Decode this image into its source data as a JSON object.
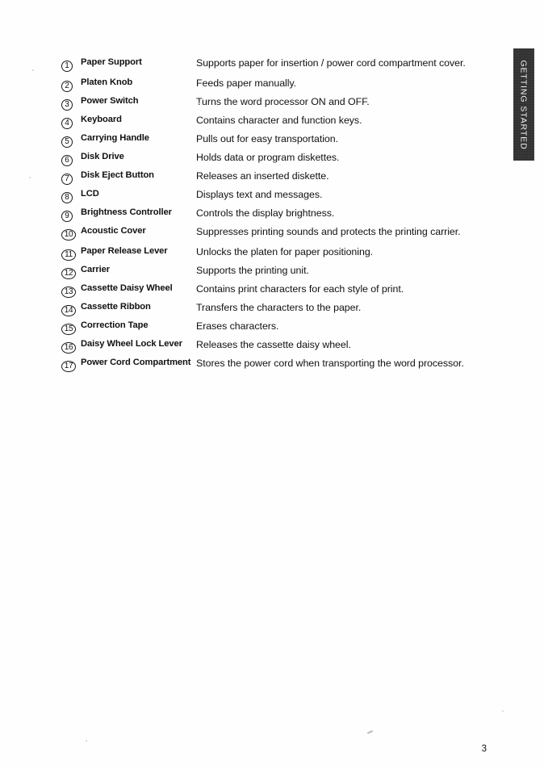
{
  "document": {
    "page_number": "3",
    "side_tab_label": "GETTING STARTED"
  },
  "parts_list": {
    "items": [
      {
        "number": "1",
        "label": "Paper Support",
        "description": "Supports paper for insertion / power cord compartment cover."
      },
      {
        "number": "2",
        "label": "Platen Knob",
        "description": "Feeds paper manually."
      },
      {
        "number": "3",
        "label": "Power Switch",
        "description": "Turns the word processor ON and OFF."
      },
      {
        "number": "4",
        "label": "Keyboard",
        "description": "Contains character and function keys."
      },
      {
        "number": "5",
        "label": "Carrying Handle",
        "description": "Pulls out for easy transportation."
      },
      {
        "number": "6",
        "label": "Disk Drive",
        "description": "Holds data or program diskettes."
      },
      {
        "number": "7",
        "label": "Disk Eject Button",
        "description": "Releases an inserted diskette."
      },
      {
        "number": "8",
        "label": "LCD",
        "description": "Displays text and messages."
      },
      {
        "number": "9",
        "label": "Brightness Controller",
        "description": "Controls the display brightness."
      },
      {
        "number": "10",
        "label": "Acoustic Cover",
        "description": "Suppresses printing sounds and protects the printing carrier."
      },
      {
        "number": "11",
        "label": "Paper Release Lever",
        "description": "Unlocks the platen for paper positioning."
      },
      {
        "number": "12",
        "label": "Carrier",
        "description": "Supports the printing unit."
      },
      {
        "number": "13",
        "label": "Cassette Daisy Wheel",
        "description": "Contains print characters for each style of print."
      },
      {
        "number": "14",
        "label": "Cassette Ribbon",
        "description": "Transfers the characters to the paper."
      },
      {
        "number": "15",
        "label": "Correction Tape",
        "description": "Erases characters."
      },
      {
        "number": "16",
        "label": "Daisy Wheel Lock Lever",
        "description": "Releases the cassette daisy wheel."
      },
      {
        "number": "17",
        "label": "Power Cord Compartment",
        "description": "Stores the power cord when transporting the word processor."
      }
    ]
  }
}
